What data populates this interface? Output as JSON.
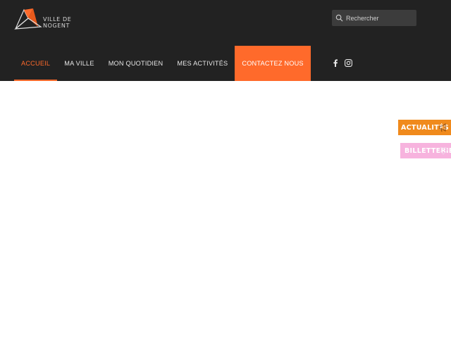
{
  "colors": {
    "header_bg": "#222222",
    "accent": "#ff6a2b",
    "news_tab": "#f08a1c",
    "ticket_tab": "#f7b3de"
  },
  "logo": {
    "text": "VILLE DE NOGENT",
    "icon": "logo-mark"
  },
  "search": {
    "placeholder": "Rechercher",
    "icon": "search-icon"
  },
  "nav": {
    "items": [
      {
        "label": "ACCUEIL",
        "active": true
      },
      {
        "label": "MA VILLE"
      },
      {
        "label": "MON QUOTIDIEN"
      },
      {
        "label": "MES ACTIVITÉS"
      },
      {
        "label": "CONTACTEZ NOUS",
        "highlight": true
      }
    ]
  },
  "social": [
    {
      "name": "facebook-icon"
    },
    {
      "name": "instagram-icon"
    }
  ],
  "side_tabs": {
    "news": {
      "label": "ACTUALITÉS",
      "icon": "megaphone-icon"
    },
    "tickets": {
      "label": "BILLETTERIE",
      "icon": "heart-icon"
    }
  }
}
